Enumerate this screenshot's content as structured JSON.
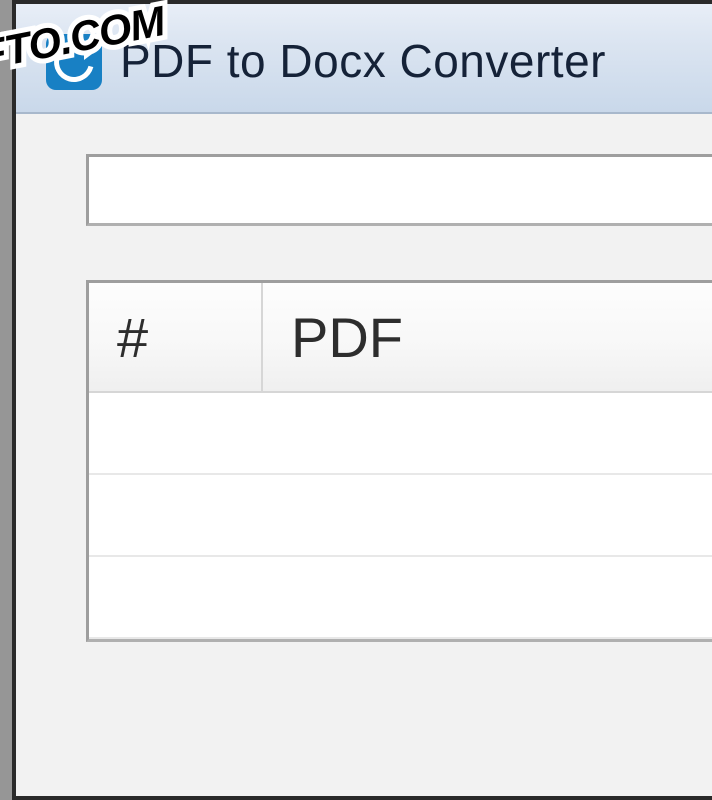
{
  "window": {
    "title": "PDF to Docx Converter"
  },
  "toolbar": {
    "path_value": ""
  },
  "table": {
    "columns": {
      "index": "#",
      "pdf": "PDF"
    },
    "rows": []
  },
  "watermark": {
    "text": "XIFTO.COM"
  }
}
